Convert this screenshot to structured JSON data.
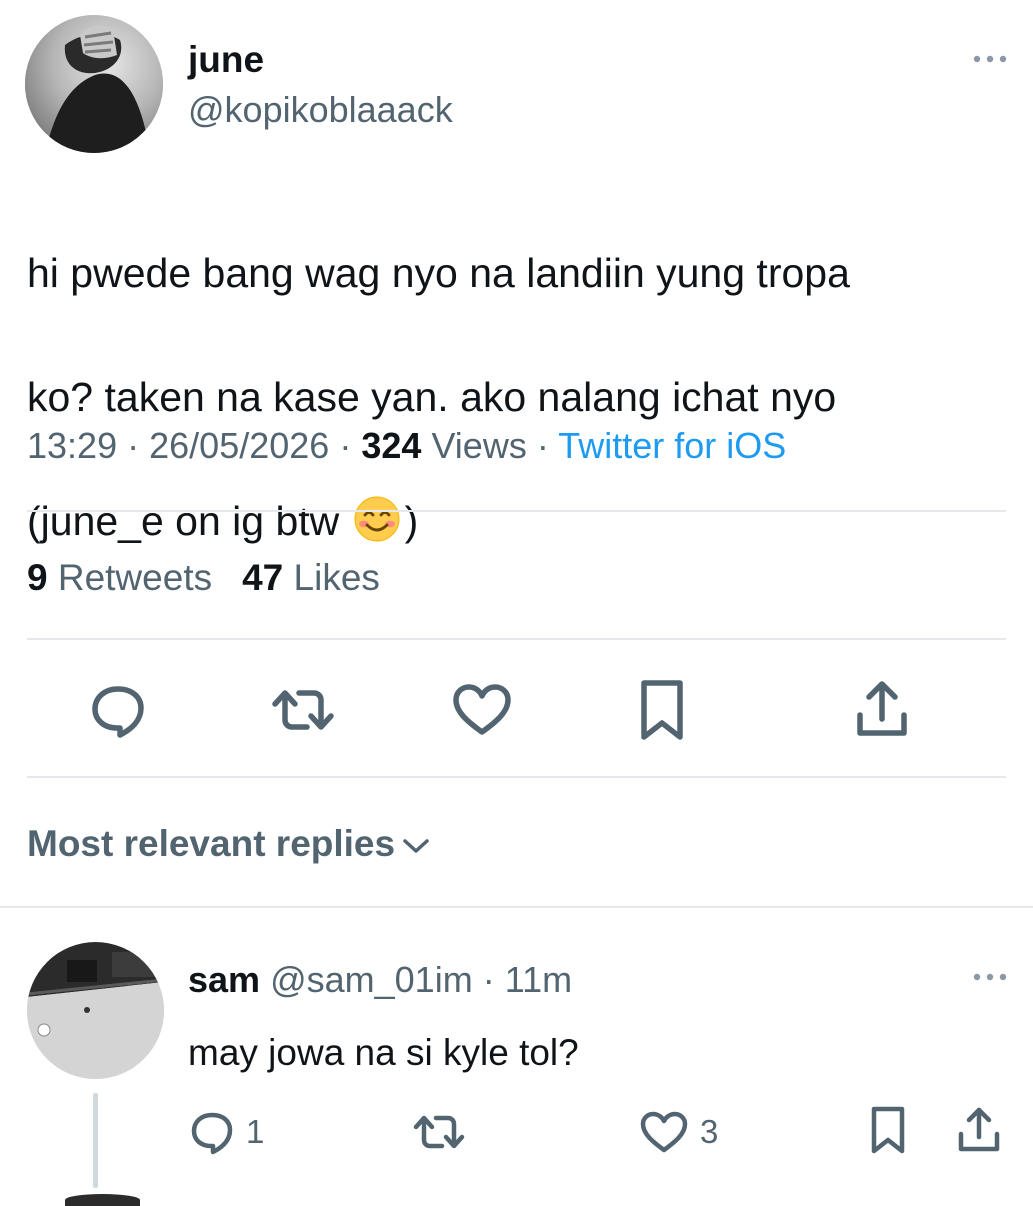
{
  "tweet": {
    "author_name": "june",
    "author_handle": "@kopikoblaaack",
    "text_line1": "hi pwede bang wag nyo na landiin yung tropa",
    "text_line2": "ko? taken na kase yan. ako nalang ichat nyo",
    "text_line3_start": "(june_e on ig btw ",
    "text_line3_end": ")",
    "emoji": "smiling-face-with-smiling-eyes",
    "time": "13:29",
    "sep": "·",
    "date": "26/05/2026",
    "views_count": "324",
    "views_label": "Views",
    "source": "Twitter for iOS",
    "retweets_count": "9",
    "retweets_label": "Retweets",
    "likes_count": "47",
    "likes_label": "Likes"
  },
  "actions": [
    "reply-icon",
    "retweet-icon",
    "like-icon",
    "bookmark-icon",
    "share-icon"
  ],
  "replies_header": {
    "label": "Most relevant replies"
  },
  "reply": {
    "author_name": "sam",
    "author_handle": "@sam_01im",
    "sep": "·",
    "time_ago": "11m",
    "text": "may jowa na si kyle tol?",
    "reply_count": "1",
    "like_count": "3"
  },
  "colors": {
    "text_primary": "#0f1419",
    "text_secondary": "#536471",
    "link": "#1d9bf0",
    "divider": "#e5e9ec"
  }
}
